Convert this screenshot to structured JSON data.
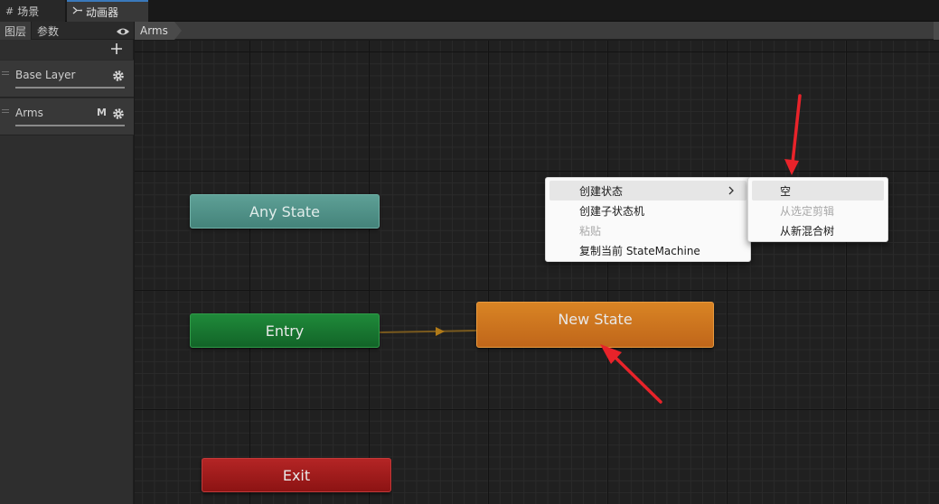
{
  "tabs": [
    {
      "label": "场景",
      "icon": "grid-icon"
    },
    {
      "label": "动画器",
      "icon": "animator-icon"
    }
  ],
  "left_panel": {
    "tabs": [
      "图层",
      "参数"
    ],
    "layers": [
      {
        "name": "Base Layer",
        "flag": ""
      },
      {
        "name": "Arms",
        "flag": "M"
      }
    ]
  },
  "breadcrumb": [
    "Arms"
  ],
  "graph": {
    "nodes": {
      "any_state": "Any State",
      "entry": "Entry",
      "new_state": "New State",
      "exit": "Exit"
    }
  },
  "context_menu": {
    "items": [
      {
        "label": "创建状态",
        "has_submenu": true,
        "enabled": true
      },
      {
        "label": "创建子状态机",
        "enabled": true
      },
      {
        "label": "粘贴",
        "enabled": false
      },
      {
        "label": "复制当前 StateMachine",
        "enabled": true
      }
    ],
    "submenu": [
      {
        "label": "空",
        "enabled": true
      },
      {
        "label": "从选定剪辑",
        "enabled": false
      },
      {
        "label": "从新混合树",
        "enabled": true
      }
    ]
  },
  "colors": {
    "any_state": "#4f9188",
    "entry": "#177a33",
    "new_state": "#cc741f",
    "exit": "#a01c1c",
    "annotation": "#e8232a"
  }
}
